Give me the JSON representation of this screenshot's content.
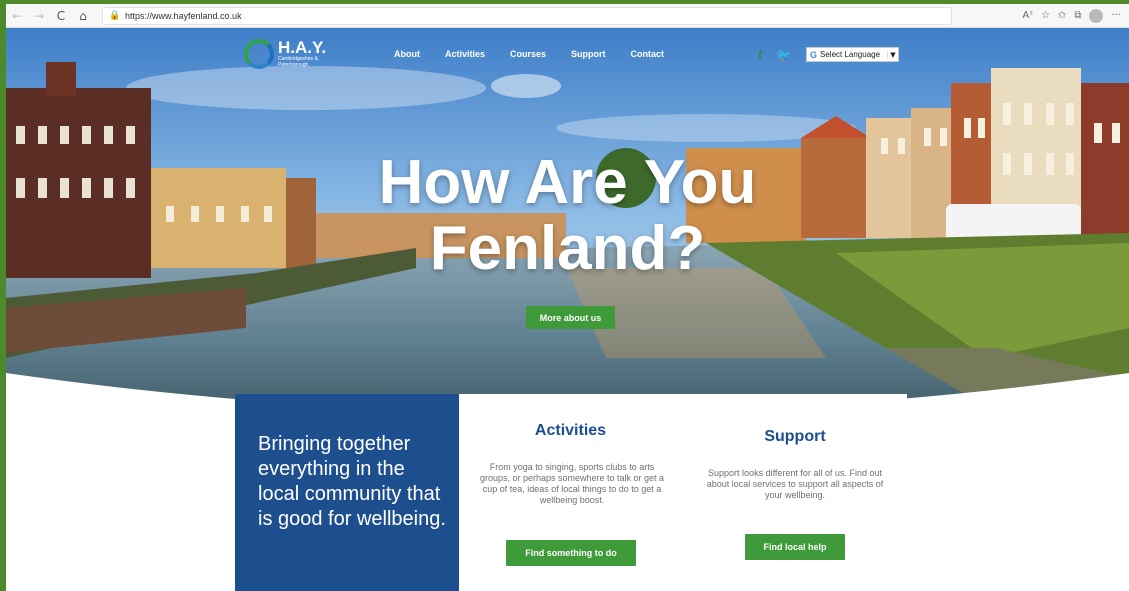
{
  "browser": {
    "url": "https://www.hayfenland.co.uk",
    "back_icon": "←",
    "forward_icon": "→",
    "refresh_icon": "C",
    "home_icon": "⌂",
    "lock_icon": "🔒",
    "read_aloud_icon": "Aˢ",
    "tracking_icon": "☆",
    "favorites_icon": "✩",
    "collections_icon": "⧉",
    "more_icon": "···"
  },
  "site": {
    "logo_text": "H.A.Y.",
    "logo_sub": "Cambridgeshire & Peterborough",
    "nav": [
      "About",
      "Activities",
      "Courses",
      "Support",
      "Contact"
    ],
    "facebook_icon": "f",
    "twitter_icon": "🐦",
    "translate_g": "G",
    "translate_label": "Select Language",
    "translate_caret": "▼"
  },
  "hero": {
    "title_line1": "How Are You",
    "title_line2": "Fenland?",
    "cta": "More about us"
  },
  "intro": {
    "text": "Bringing together everything in the local community that is good for wellbeing."
  },
  "activities": {
    "title": "Activities",
    "text": "From yoga to singing, sports clubs to arts groups, or perhaps somewhere to talk or get a cup of tea, ideas of local things to do to get a wellbeing boost.",
    "button": "Find something to do"
  },
  "support": {
    "title": "Support",
    "text": "Support looks different for all of us. Find out about local services to support all aspects of your wellbeing.",
    "button": "Find local help"
  },
  "colors": {
    "brand_blue": "#1d4f8f",
    "brand_green": "#3f9b3a",
    "frame_green": "#4d8a2c"
  }
}
